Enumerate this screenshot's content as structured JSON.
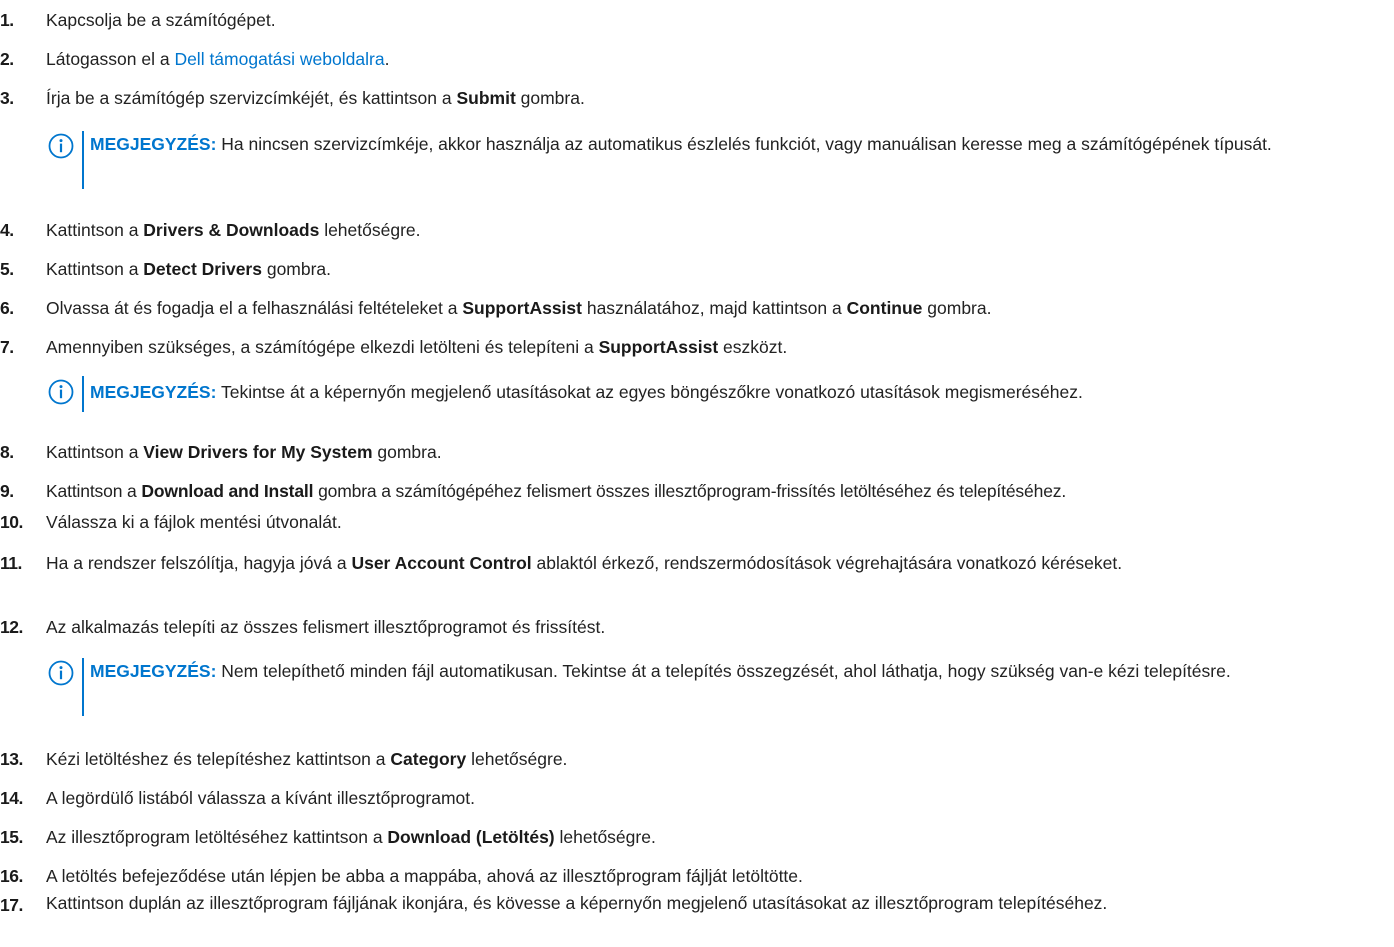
{
  "steps": [
    {
      "num": "1.",
      "a": "Kapcsolja be a számítógépet."
    },
    {
      "num": "2.",
      "a": "Látogasson el a ",
      "link": "Dell támogatási weboldalra",
      "c": "."
    },
    {
      "num": "3.",
      "a": "Írja be a számítógép szervizcímkéjét, és kattintson a ",
      "b": "Submit",
      "c": " gombra."
    },
    {
      "num": "4.",
      "a": "Kattintson a ",
      "b": "Drivers & Downloads",
      "c": " lehetőségre."
    },
    {
      "num": "5.",
      "a": "Kattintson a ",
      "b": "Detect Drivers",
      "c": " gombra."
    },
    {
      "num": "6.",
      "a": "Olvassa át és fogadja el a felhasználási feltételeket a ",
      "b": "SupportAssist",
      "c": " használatához, majd kattintson a ",
      "d": "Continue",
      "e": " gombra."
    },
    {
      "num": "7.",
      "a": "Amennyiben szükséges, a számítógépe elkezdi letölteni és telepíteni a ",
      "b": "SupportAssist",
      "c": " eszközt."
    },
    {
      "num": "8.",
      "a": "Kattintson a ",
      "b": "View Drivers for My System",
      "c": " gombra."
    },
    {
      "num": "9.",
      "a": "Kattintson a ",
      "b": "Download and Install",
      "c": " gombra a számítógépéhez felismert összes illesztőprogram-frissítés letöltéséhez és telepítéséhez."
    },
    {
      "num": "10.",
      "a": "Válassza ki a fájlok mentési útvonalát."
    },
    {
      "num": "11.",
      "a": "Ha a rendszer felszólítja, hagyja jóvá a ",
      "b": "User Account Control",
      "c": " ablaktól érkező, rendszermódosítások végrehajtására vonatkozó kéréseket."
    },
    {
      "num": "12.",
      "a": "Az alkalmazás telepíti az összes felismert illesztőprogramot és frissítést."
    },
    {
      "num": "13.",
      "a": "Kézi letöltéshez és telepítéshez kattintson a ",
      "b": "Category",
      "c": " lehetőségre."
    },
    {
      "num": "14.",
      "a": "A legördülő listából válassza a kívánt illesztőprogramot."
    },
    {
      "num": "15.",
      "a": "Az illesztőprogram letöltéséhez kattintson a ",
      "b": "Download (Letöltés)",
      "c": " lehetőségre."
    },
    {
      "num": "16.",
      "a": "A letöltés befejeződése után lépjen be abba a mappába, ahová az illesztőprogram fájlját letöltötte."
    },
    {
      "num": "17.",
      "a": "Kattintson duplán az illesztőprogram fájljának ikonjára, és kövesse a képernyőn megjelenő utasításokat az illesztőprogram telepítéséhez."
    }
  ],
  "notes": [
    {
      "label": "MEGJEGYZÉS:",
      "text": " Ha nincsen szervizcímkéje, akkor használja az automatikus észlelés funkciót, vagy manuálisan keresse meg a számítógépének típusát."
    },
    {
      "label": "MEGJEGYZÉS:",
      "text": " Tekintse át a képernyőn megjelenő utasításokat az egyes böngészőkre vonatkozó utasítások megismeréséhez."
    },
    {
      "label": "MEGJEGYZÉS:",
      "text": " Nem telepíthető minden fájl automatikusan. Tekintse át a telepítés összegzését, ahol láthatja, hogy szükség van-e kézi telepítésre."
    }
  ],
  "icons": {
    "note": "info-circle-icon"
  },
  "colors": {
    "accent": "#0076ce",
    "text": "#222222"
  }
}
